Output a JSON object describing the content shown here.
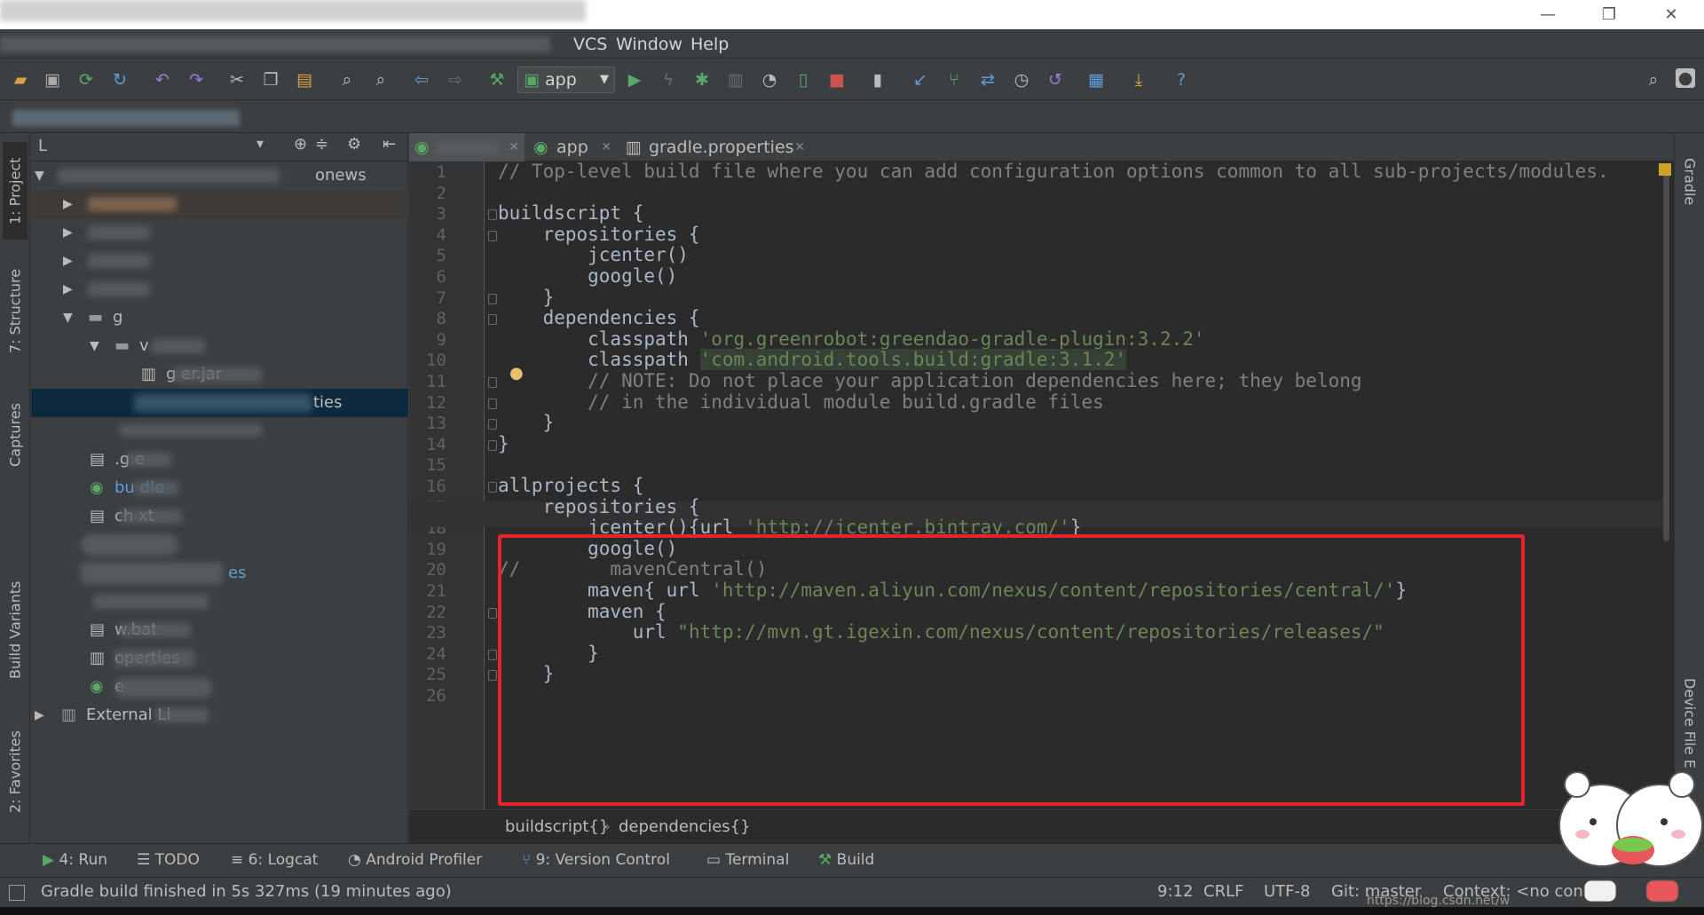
{
  "window": {
    "minimize_icon": "—",
    "restore_icon": "❐",
    "close_icon": "✕"
  },
  "menu": [
    "VCS",
    "Window",
    "Help"
  ],
  "toolbar": {
    "run_config": "app"
  },
  "left_tabs": [
    "1: Project",
    "7: Structure",
    "Captures",
    "Build Variants",
    "2: Favorites"
  ],
  "right_tabs": [
    "Gradle",
    "Device File E"
  ],
  "project": {
    "rows": [
      {
        "text": "onews"
      },
      {
        "text": "g"
      },
      {
        "text": "v"
      },
      {
        "text": "g                    er.jar"
      },
      {
        "text": "ties"
      },
      {
        "text": ".g         e"
      },
      {
        "text": "bu        dle"
      },
      {
        "text": "ch          xt"
      },
      {
        "text": "es"
      },
      {
        "text": "w.bat"
      },
      {
        "text": "operties"
      },
      {
        "text": "e"
      },
      {
        "text": "External Li"
      }
    ]
  },
  "editor": {
    "tabs": [
      {
        "label": "app"
      },
      {
        "label": "gradle.properties"
      }
    ],
    "lines": [
      {
        "n": "1"
      },
      {
        "n": "2"
      },
      {
        "n": "3"
      },
      {
        "n": "4"
      },
      {
        "n": "5"
      },
      {
        "n": "6"
      },
      {
        "n": "7"
      },
      {
        "n": "8"
      },
      {
        "n": "9"
      },
      {
        "n": "10"
      },
      {
        "n": "11"
      },
      {
        "n": "12"
      },
      {
        "n": "13"
      },
      {
        "n": "14"
      },
      {
        "n": "15"
      },
      {
        "n": "16"
      },
      {
        "n": "17"
      },
      {
        "n": "18"
      },
      {
        "n": "19"
      },
      {
        "n": "20"
      },
      {
        "n": "21"
      },
      {
        "n": "22"
      },
      {
        "n": "23"
      },
      {
        "n": "24"
      },
      {
        "n": "25"
      },
      {
        "n": "26"
      }
    ],
    "code": {
      "l1": "// Top-level build file where you can add configuration options common to all sub-projects/modules.",
      "l3": "buildscript {",
      "l4": "    repositories {",
      "l5": "        jcenter()",
      "l6": "        google()",
      "l7": "    }",
      "l8": "    dependencies {",
      "l9a": "        classpath ",
      "l9b": "'org.greenrobot:greendao-gradle-plugin:3.2.2'",
      "l10a": "        classpath ",
      "l10b": "'com.android.tools.build:gradle:3.1.2'",
      "l11": "        // NOTE: Do not place your application dependencies here; they belong",
      "l12": "        // in the individual module build.gradle files",
      "l13": "    }",
      "l14": "}",
      "l16": "allprojects {",
      "l17": "    repositories {",
      "l18a": "        jcenter(){url ",
      "l18b": "'http://jcenter.bintray.com/'",
      "l18c": "}",
      "l19": "        google()",
      "l20": "//        mavenCentral()",
      "l21a": "        maven{ url ",
      "l21b": "'http://maven.aliyun.com/nexus/content/repositories/central/'",
      "l21c": "}",
      "l22": "        maven {",
      "l23a": "            url ",
      "l23b": "\"http://mvn.gt.igexin.com/nexus/content/repositories/releases/\"",
      "l24": "        }",
      "l25": "    }"
    },
    "breadcrumbs": [
      "buildscript{}",
      "dependencies{}"
    ]
  },
  "bottom_tabs": [
    {
      "label": "4: Run"
    },
    {
      "label": "TODO"
    },
    {
      "label": "6: Logcat"
    },
    {
      "label": "Android Profiler"
    },
    {
      "label": "9: Version Control"
    },
    {
      "label": "Terminal"
    },
    {
      "label": "Build"
    }
  ],
  "status": {
    "message": "Gradle build finished in 5s 327ms (19 minutes ago)",
    "position": "9:12",
    "line_sep": "CRLF",
    "encoding": "UTF-8",
    "git": "Git: master",
    "context": "Context: <no con",
    "watermark": "https://blog.csdn.net/w"
  },
  "colors": {
    "highlight_box": "#e8242a",
    "string": "#6a8759",
    "comment": "#808080",
    "run_green": "#59a869",
    "stop_red": "#c75450"
  }
}
